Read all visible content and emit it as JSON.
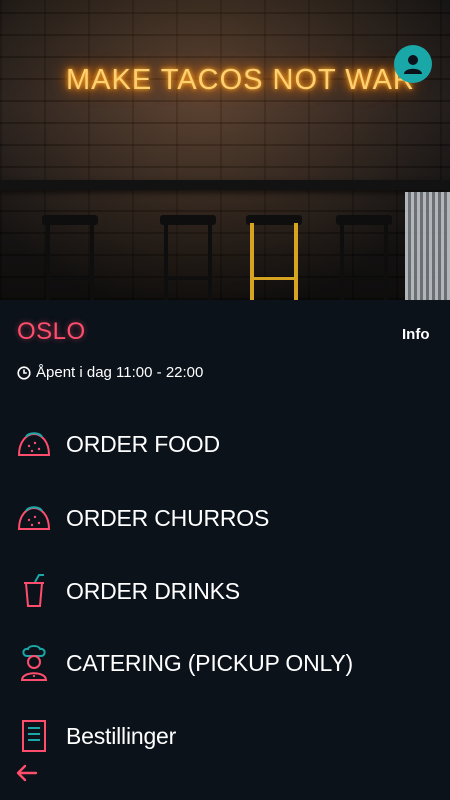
{
  "hero": {
    "neon_text": "MAKE TACOS NOT WAR"
  },
  "header": {
    "location": "OSLO",
    "info_label": "Info",
    "opening_hours": "Åpent i dag 11:00 - 22:00"
  },
  "menu": {
    "items": [
      {
        "label": "ORDER FOOD",
        "icon": "taco-icon"
      },
      {
        "label": "ORDER CHURROS",
        "icon": "taco-icon"
      },
      {
        "label": "ORDER DRINKS",
        "icon": "drink-cup-icon"
      },
      {
        "label": "CATERING (PICKUP ONLY)",
        "icon": "chef-icon"
      },
      {
        "label": "Bestillinger",
        "icon": "receipt-icon"
      }
    ]
  },
  "colors": {
    "background": "#0b121a",
    "accent_red": "#ff4d6d",
    "accent_teal": "#1aa7a7"
  }
}
